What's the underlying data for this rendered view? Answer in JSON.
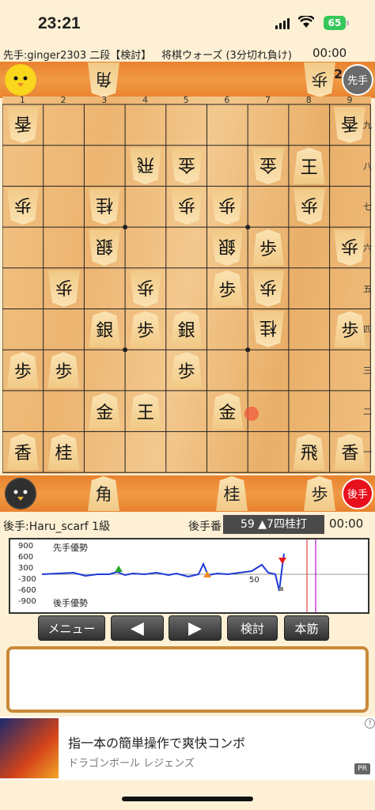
{
  "status": {
    "time": "23:21",
    "battery": "65"
  },
  "info": {
    "sente": "先手:ginger2303 二段【検討】",
    "game": "将棋ウォーズ (3分切れ負け)",
    "clock": "00:00"
  },
  "top_hand": {
    "count": "2",
    "badge": "先手",
    "pieces": [
      "角",
      "歩"
    ]
  },
  "bottom_hand": {
    "badge": "後手",
    "pieces": [
      "角",
      "桂",
      "歩"
    ]
  },
  "files": [
    "1",
    "2",
    "3",
    "4",
    "5",
    "6",
    "7",
    "8",
    "9"
  ],
  "ranks": [
    "九",
    "八",
    "七",
    "六",
    "五",
    "四",
    "三",
    "二",
    "一"
  ],
  "pieces": [
    {
      "col": 0,
      "row": 0,
      "ch": "香",
      "gote": true
    },
    {
      "col": 8,
      "row": 0,
      "ch": "香",
      "gote": true
    },
    {
      "col": 3,
      "row": 1,
      "ch": "飛",
      "gote": true
    },
    {
      "col": 4,
      "row": 1,
      "ch": "金",
      "gote": true
    },
    {
      "col": 6,
      "row": 1,
      "ch": "金",
      "gote": true
    },
    {
      "col": 7,
      "row": 1,
      "ch": "王",
      "gote": false
    },
    {
      "col": 0,
      "row": 2,
      "ch": "歩",
      "gote": true
    },
    {
      "col": 2,
      "row": 2,
      "ch": "桂",
      "gote": true
    },
    {
      "col": 4,
      "row": 2,
      "ch": "歩",
      "gote": true
    },
    {
      "col": 5,
      "row": 2,
      "ch": "歩",
      "gote": true
    },
    {
      "col": 7,
      "row": 2,
      "ch": "歩",
      "gote": true
    },
    {
      "col": 2,
      "row": 3,
      "ch": "銀",
      "gote": true
    },
    {
      "col": 5,
      "row": 3,
      "ch": "銀",
      "gote": true
    },
    {
      "col": 6,
      "row": 3,
      "ch": "歩",
      "gote": false
    },
    {
      "col": 8,
      "row": 3,
      "ch": "歩",
      "gote": true
    },
    {
      "col": 1,
      "row": 4,
      "ch": "歩",
      "gote": true
    },
    {
      "col": 3,
      "row": 4,
      "ch": "歩",
      "gote": true
    },
    {
      "col": 5,
      "row": 4,
      "ch": "歩",
      "gote": false
    },
    {
      "col": 6,
      "row": 4,
      "ch": "歩",
      "gote": true
    },
    {
      "col": 2,
      "row": 5,
      "ch": "銀",
      "gote": false
    },
    {
      "col": 3,
      "row": 5,
      "ch": "歩",
      "gote": false
    },
    {
      "col": 4,
      "row": 5,
      "ch": "銀",
      "gote": false
    },
    {
      "col": 6,
      "row": 5,
      "ch": "桂",
      "gote": true
    },
    {
      "col": 8,
      "row": 5,
      "ch": "歩",
      "gote": false
    },
    {
      "col": 0,
      "row": 6,
      "ch": "歩",
      "gote": false
    },
    {
      "col": 1,
      "row": 6,
      "ch": "歩",
      "gote": false
    },
    {
      "col": 4,
      "row": 6,
      "ch": "歩",
      "gote": false
    },
    {
      "col": 2,
      "row": 7,
      "ch": "金",
      "gote": false
    },
    {
      "col": 3,
      "row": 7,
      "ch": "王",
      "gote": false
    },
    {
      "col": 5,
      "row": 7,
      "ch": "金",
      "gote": false
    },
    {
      "col": 0,
      "row": 8,
      "ch": "香",
      "gote": false
    },
    {
      "col": 1,
      "row": 8,
      "ch": "桂",
      "gote": false
    },
    {
      "col": 7,
      "row": 8,
      "ch": "飛",
      "gote": false
    },
    {
      "col": 8,
      "row": 8,
      "ch": "香",
      "gote": false
    }
  ],
  "moveinfo": {
    "gote": "後手:Haru_scarf 1級",
    "turn": "後手番",
    "move": "59 ▲7四桂打",
    "clock": "00:00"
  },
  "graph": {
    "top_label": "先手優勢",
    "bottom_label": "後手優勢",
    "yticks": [
      "900",
      "600",
      "300",
      "-300",
      "-600",
      "-900"
    ],
    "marker": "50"
  },
  "buttons": {
    "menu": "メニュー",
    "prev": "◀",
    "next": "▶",
    "analyze": "検討",
    "main": "本筋"
  },
  "ad": {
    "title": "指一本の簡単操作で爽快コンボ",
    "subtitle": "ドラゴンボール レジェンズ",
    "badge": "PR",
    "info": "?"
  }
}
